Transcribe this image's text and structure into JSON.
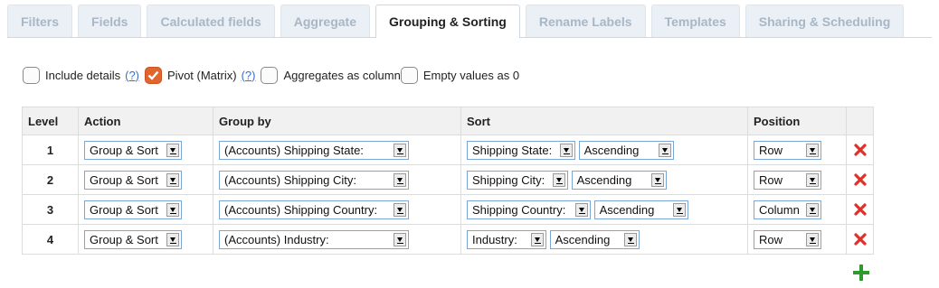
{
  "tabs": [
    {
      "label": "Filters",
      "active": false
    },
    {
      "label": "Fields",
      "active": false
    },
    {
      "label": "Calculated fields",
      "active": false
    },
    {
      "label": "Aggregate",
      "active": false
    },
    {
      "label": "Grouping & Sorting",
      "active": true
    },
    {
      "label": "Rename Labels",
      "active": false
    },
    {
      "label": "Templates",
      "active": false
    },
    {
      "label": "Sharing & Scheduling",
      "active": false
    }
  ],
  "options": {
    "include_details": {
      "label": "Include details",
      "help": "(?)",
      "checked": false
    },
    "pivot": {
      "label": "Pivot (Matrix)",
      "help": "(?)",
      "checked": true
    },
    "aggregates_as_column": {
      "label": "Aggregates as column",
      "checked": false
    },
    "empty_values_as_0": {
      "label": "Empty values as 0",
      "checked": false
    }
  },
  "table": {
    "headers": {
      "level": "Level",
      "action": "Action",
      "group_by": "Group by",
      "sort": "Sort",
      "position": "Position"
    },
    "rows": [
      {
        "level": "1",
        "action": "Group & Sort",
        "group_by": "(Accounts) Shipping State:",
        "sort_field": "Shipping State:",
        "sort_order": "Ascending",
        "position": "Row"
      },
      {
        "level": "2",
        "action": "Group & Sort",
        "group_by": "(Accounts) Shipping City:",
        "sort_field": "Shipping City:",
        "sort_order": "Ascending",
        "position": "Row"
      },
      {
        "level": "3",
        "action": "Group & Sort",
        "group_by": "(Accounts) Shipping Country:",
        "sort_field": "Shipping Country:",
        "sort_order": "Ascending",
        "position": "Column"
      },
      {
        "level": "4",
        "action": "Group & Sort",
        "group_by": "(Accounts) Industry:",
        "sort_field": "Industry:",
        "sort_order": "Ascending",
        "position": "Row"
      }
    ]
  },
  "icons": {
    "delete": "delete-x-icon",
    "add": "plus-icon"
  },
  "colors": {
    "delete": "#e0302a",
    "add": "#2e9a2e",
    "checkbox_checked": "#e0662e",
    "help_link": "#3a6fc4"
  }
}
